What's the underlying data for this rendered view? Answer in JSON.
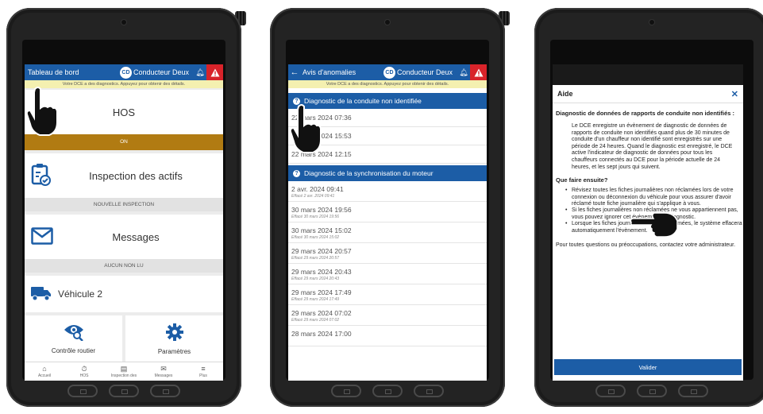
{
  "colors": {
    "primary": "#1c5da6",
    "alert": "#d8232a",
    "hos_status": "#b17b12",
    "banner": "#f4f0b0"
  },
  "header": {
    "driver_initials": "CD",
    "driver_name": "Conducteur Deux",
    "bell_icon": "bell-icon",
    "alert_icon": "warning-triangle-icon"
  },
  "banner_text": "Votre DCE a des diagnostics. Appuyez pour obtenir des détails.",
  "screen1": {
    "title": "Tableau de bord",
    "hos": {
      "label": "HOS",
      "status": "ON"
    },
    "inspection": {
      "label": "Inspection des actifs",
      "sub": "NOUVELLE INSPECTION"
    },
    "messages": {
      "label": "Messages",
      "sub": "AUCUN NON LU"
    },
    "vehicle": {
      "label": "Véhicule 2"
    },
    "tiles": [
      {
        "label": "Contrôle routier"
      },
      {
        "label": "Paramètres"
      }
    ],
    "bottom_nav": [
      {
        "label": "Accueil"
      },
      {
        "label": "HOS"
      },
      {
        "label": "Inspection des"
      },
      {
        "label": "Messages"
      },
      {
        "label": "Plus"
      }
    ]
  },
  "screen2": {
    "title": "Avis d'anomalies",
    "section1": {
      "title": "Diagnostic de la conduite non identifiée",
      "items": [
        {
          "date": "22 mars 2024 07:36"
        },
        {
          "date": "22 mars 2024 15:53"
        },
        {
          "date": "22 mars 2024 12:15"
        }
      ]
    },
    "section2": {
      "title": "Diagnostic de la synchronisation du moteur",
      "items": [
        {
          "date": "2 avr. 2024 09:41",
          "sub": "Effacé 2 avr. 2024 09:41"
        },
        {
          "date": "30 mars 2024 19:56",
          "sub": "Effacé 30 mars 2024 19:56"
        },
        {
          "date": "30 mars 2024 15:02",
          "sub": "Effacé 30 mars 2024 15:02"
        },
        {
          "date": "29 mars 2024 20:57",
          "sub": "Effacé 29 mars 2024 20:57"
        },
        {
          "date": "29 mars 2024 20:43",
          "sub": "Effacé 29 mars 2024 20:43"
        },
        {
          "date": "29 mars 2024 17:49",
          "sub": "Effacé 29 mars 2024 17:49"
        },
        {
          "date": "29 mars 2024 07:02",
          "sub": "Effacé 29 mars 2024 07:02"
        },
        {
          "date": "28 mars 2024 17:00",
          "sub": ""
        }
      ]
    }
  },
  "screen3": {
    "title": "Aide",
    "heading": "Diagnostic de données de rapports de conduite non identifiés :",
    "paragraph": "Le DCE enregistre un évènement de diagnostic de données de rapports de conduite non identifiés quand plus de 30 minutes de conduite d'un chauffeur non identifié sont enregistrés sur une période de 24 heures. Quand le diagnostic est enregistré, le DCE active l'indicateur de diagnostic de données pour tous les chauffeurs connectés au DCE pour la période actuelle de 24 heures, et les sept jours qui suivent.",
    "next_heading": "Que faire ensuite?",
    "bullets": [
      "Révisez toutes les fiches journalières non réclamées lors de votre connexion ou déconnexion du véhicule pour vous assurer d'avoir réclamé toute fiche journalière qui s'applique à vous.",
      "Si les fiches journalières non réclamées ne vous appartiennent pas, vous pouvez ignorer cet évènement de diagnostic.",
      "Lorsque les fiches journalières seront réclamées, le système effacera automatiquement l'évènement."
    ],
    "footer": "Pour toutes questions ou préoccupations, contactez votre administrateur.",
    "button": "Valider"
  }
}
